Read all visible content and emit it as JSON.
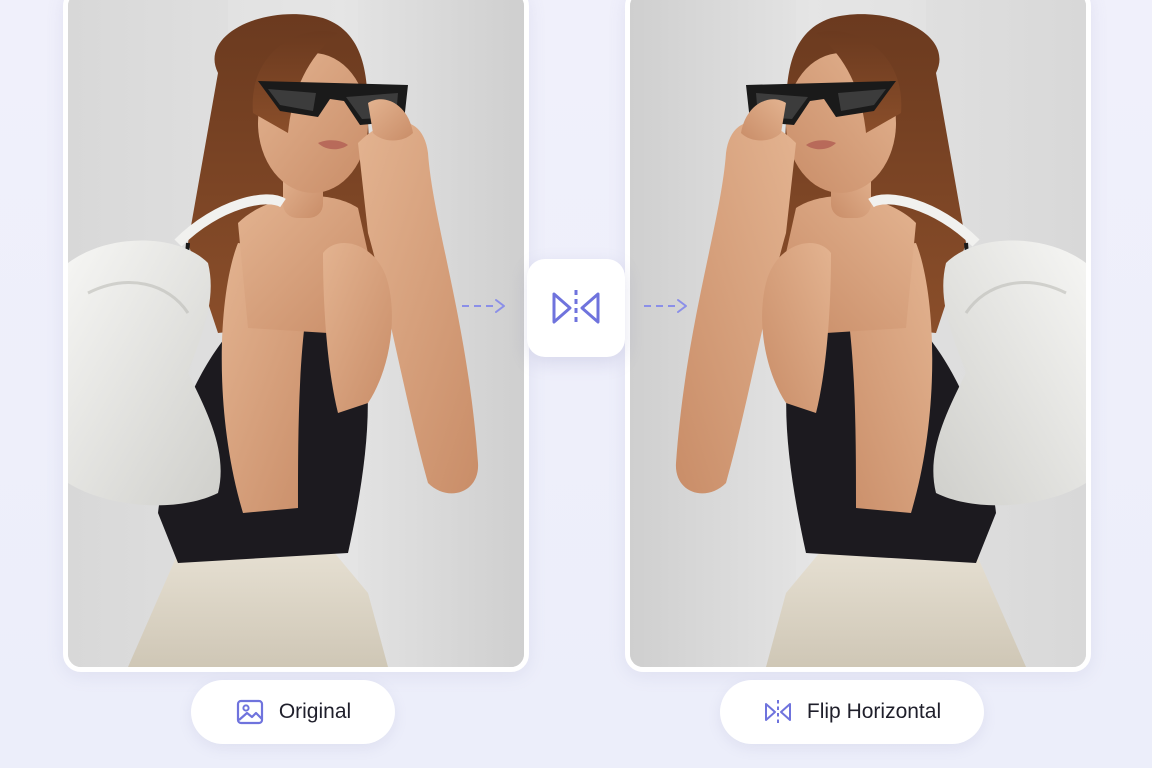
{
  "panels": {
    "original": {
      "image_subject": "woman with sunglasses and white shoulder bag"
    },
    "flipped": {
      "image_subject": "woman with sunglasses and white shoulder bag (mirrored)"
    }
  },
  "labels": {
    "original": "Original",
    "flip_horizontal": "Flip Horizontal"
  },
  "icons": {
    "original_icon": "image-icon",
    "flip_icon": "flip-horizontal-icon",
    "center_icon": "flip-horizontal-icon",
    "arrow_icon": "dashed-arrow-icon"
  },
  "colors": {
    "accent": "#6f73dd",
    "background": "#eeeffa",
    "card": "#ffffff",
    "text": "#1f1f2b"
  }
}
